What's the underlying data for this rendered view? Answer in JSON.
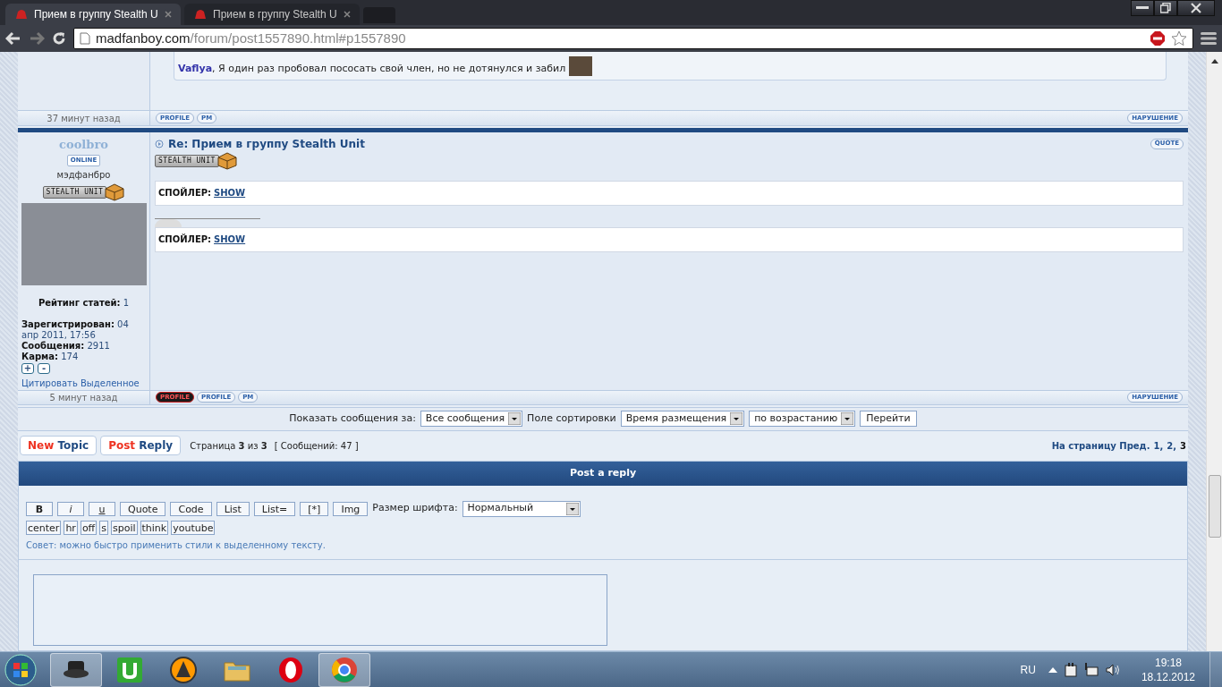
{
  "browser": {
    "tabs": [
      {
        "title": "Прием в группу Stealth U",
        "selected": true
      },
      {
        "title": "Прием в группу Stealth U",
        "selected": false
      }
    ],
    "url": {
      "domain": "madfanboy.com",
      "path": "/forum/post1557890.html#p1557890"
    }
  },
  "previous_post": {
    "quote_author": "Vaflya",
    "quote_text": ", Я один раз пробовал пососать свой член, но не дотянулся и забил",
    "footer": {
      "time": "37 минут назад",
      "buttons": [
        {
          "label": "PROFILE",
          "kind": "plain"
        },
        {
          "label": "PM",
          "kind": "plain"
        }
      ],
      "report": "НАРУШЕНИЕ"
    }
  },
  "post": {
    "author": "coolbro",
    "status": "ONLINE",
    "rank": "мэдфанбро",
    "rank_badge": "STEALTH UNIT",
    "stats": [
      {
        "label": "Рейтинг статей:",
        "value": "1"
      },
      {
        "label": "Зарегистрирован:",
        "value": "04 апр 2011, 17:56"
      },
      {
        "label": "Сообщения:",
        "value": "2911"
      },
      {
        "label": "Карма:",
        "value": "174"
      }
    ],
    "karma_buttons": [
      "+",
      "-"
    ],
    "quote_selected": "Цитировать Выделенное",
    "title": "Re: Прием в группу Stealth Unit",
    "quote_button": "QUOTE",
    "body_badge": "STEALTH UNIT",
    "spoilers": [
      {
        "label": "СПОЙЛЕР:",
        "link": "SHOW"
      },
      {
        "label": "СПОЙЛЕР:",
        "link": "SHOW"
      }
    ],
    "footer": {
      "time": "5 минут назад",
      "buttons": [
        {
          "label": "PROFILE",
          "kind": "dark"
        },
        {
          "label": "PROFILE",
          "kind": "plain"
        },
        {
          "label": "PM",
          "kind": "plain"
        }
      ],
      "report": "НАРУШЕНИЕ"
    }
  },
  "sort_bar": {
    "show_label": "Показать сообщения за:",
    "show_value": "Все сообщения",
    "sort_label": "Поле сортировки",
    "sort_value": "Время размещения",
    "order_value": "по возрастанию",
    "go_button": "Перейти"
  },
  "actions": {
    "buttons": [
      {
        "first": "New",
        "second": "Topic"
      },
      {
        "first": "Post",
        "second": "Reply"
      }
    ],
    "page_info": "Страница **3** из **3**",
    "post_count": "[ Сообщений: 47 ]",
    "pagination_label": "На страницу Пред.",
    "pages": [
      {
        "label": "1,",
        "selected": false
      },
      {
        "label": "2,",
        "selected": false
      },
      {
        "label": "3",
        "selected": true
      }
    ]
  },
  "reply": {
    "title": "Post a reply",
    "format_buttons": [
      "B",
      "i",
      "u",
      "Quote",
      "Code",
      "List",
      "List=",
      "[*]",
      "Img"
    ],
    "font_size_label": "Размер шрифта:",
    "font_size_value": "Нормальный",
    "tag_buttons": [
      "center",
      "hr",
      "off",
      "s",
      "spoil",
      "think",
      "youtube"
    ],
    "tip": "Совет: можно быстро применить стили к выделенному тексту."
  },
  "taskbar": {
    "apps": [
      {
        "kind": "hat",
        "selected": true
      },
      {
        "kind": "torrent",
        "selected": false
      },
      {
        "kind": "aimp",
        "selected": false
      },
      {
        "kind": "folder",
        "selected": false
      },
      {
        "kind": "opera",
        "selected": false
      },
      {
        "kind": "chrome",
        "selected": true
      }
    ],
    "language": "RU",
    "time": "19:18",
    "date": "18.12.2012"
  }
}
